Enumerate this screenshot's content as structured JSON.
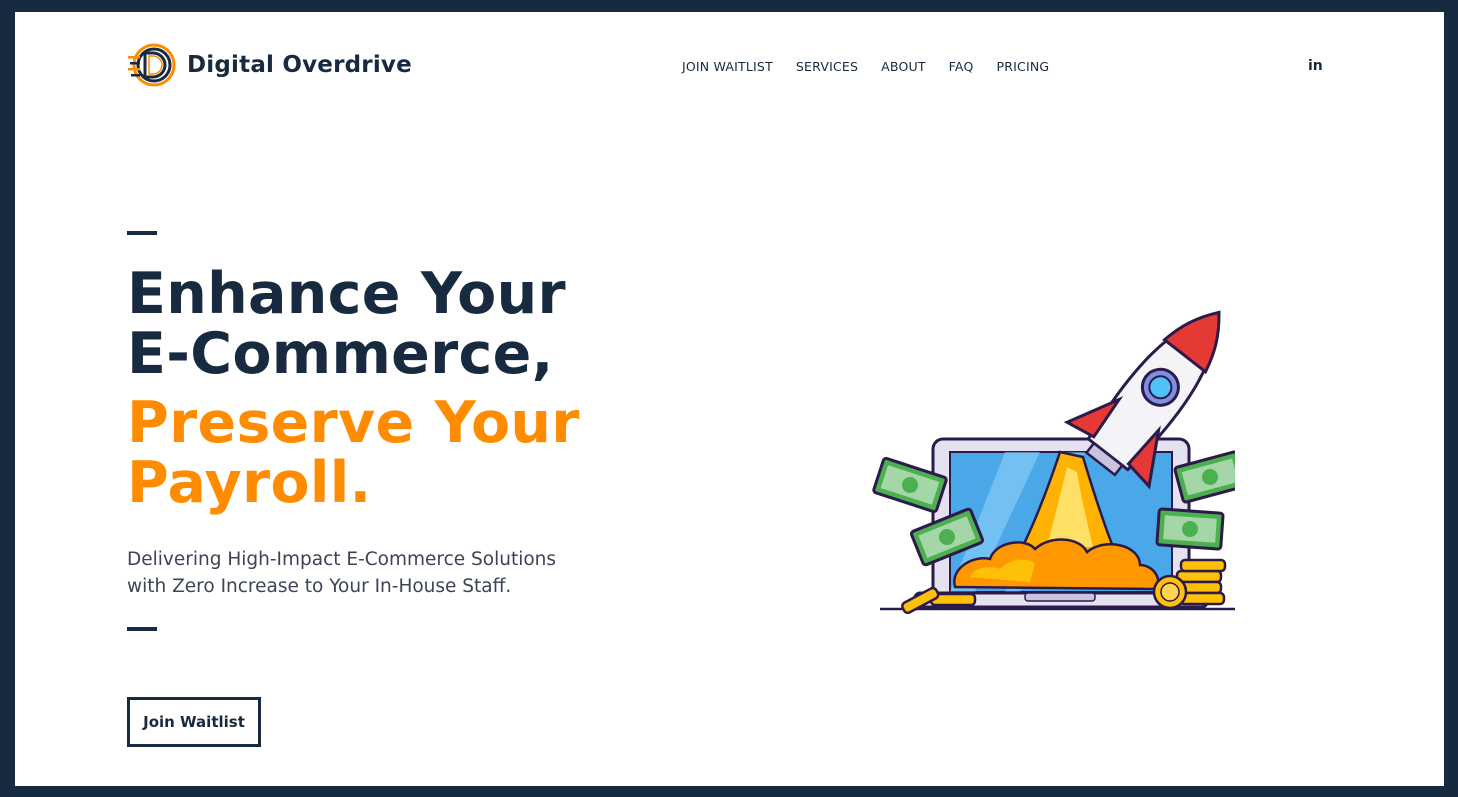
{
  "header": {
    "brand": "Digital Overdrive",
    "nav": [
      "JOIN WAITLIST",
      "SERVICES",
      "ABOUT",
      "FAQ",
      "PRICING"
    ],
    "social": "in"
  },
  "hero": {
    "headline_line1": "Enhance Your",
    "headline_line2": "E-Commerce,",
    "headline_line3": "Preserve Your",
    "headline_line4": "Payroll.",
    "subtitle_line1": "Delivering High-Impact E-Commerce Solutions",
    "subtitle_line2": "with Zero Increase to Your In-House Staff.",
    "cta_label": "Join Waitlist",
    "illustration": "rocket-laptop-illustration"
  },
  "colors": {
    "frame": "#172a40",
    "navy": "#172a40",
    "accent": "#ff8c00",
    "background": "#ffffff"
  }
}
